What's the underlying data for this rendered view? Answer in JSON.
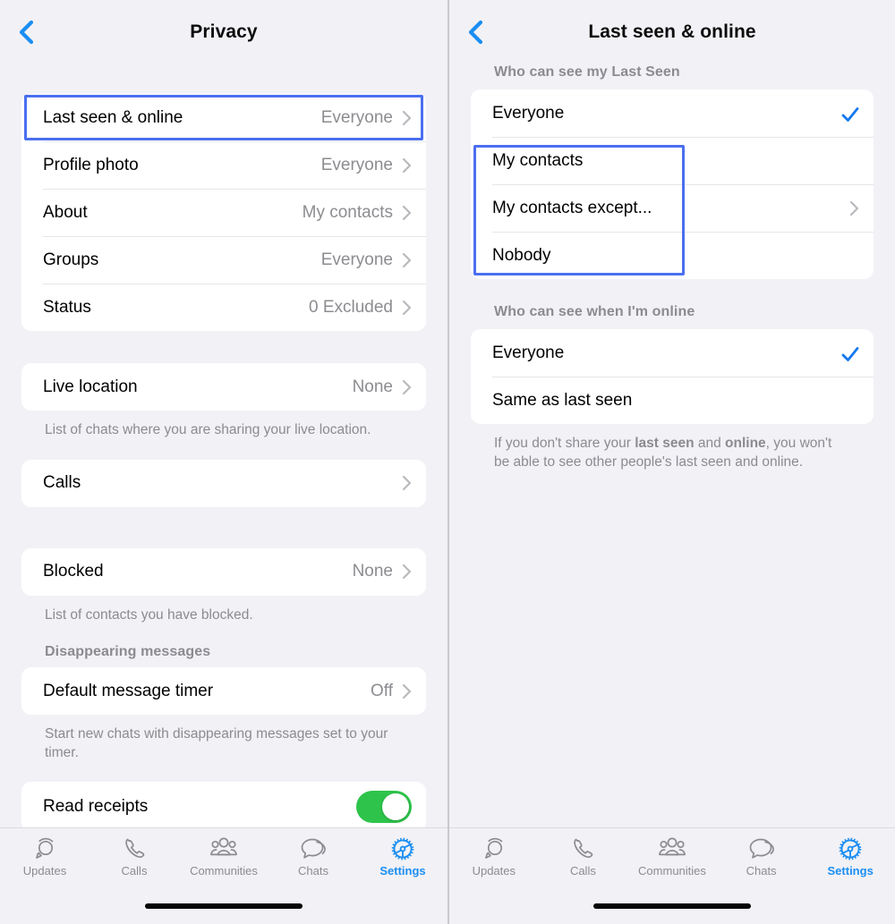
{
  "theme": {
    "background": "#f2f1f6",
    "card": "#ffffff",
    "accent_blue": "#1b8ef2",
    "highlight_border": "#4a6ff0",
    "toggle_on": "#2ec44b",
    "secondary_text": "#8b8b90"
  },
  "left_panel": {
    "header": {
      "title": "Privacy",
      "back_icon": "chevron-left-icon"
    },
    "group_1": [
      {
        "label": "Last seen & online",
        "value": "Everyone",
        "accessory": "chevron-right-icon",
        "highlighted": true
      },
      {
        "label": "Profile photo",
        "value": "Everyone",
        "accessory": "chevron-right-icon"
      },
      {
        "label": "About",
        "value": "My contacts",
        "accessory": "chevron-right-icon"
      },
      {
        "label": "Groups",
        "value": "Everyone",
        "accessory": "chevron-right-icon"
      },
      {
        "label": "Status",
        "value": "0 Excluded",
        "accessory": "chevron-right-icon"
      }
    ],
    "group_2": [
      {
        "label": "Live location",
        "value": "None",
        "accessory": "chevron-right-icon"
      }
    ],
    "caption_2": "List of chats where you are sharing your live location.",
    "group_3": [
      {
        "label": "Calls",
        "value": "",
        "accessory": "chevron-right-icon"
      }
    ],
    "group_4": [
      {
        "label": "Blocked",
        "value": "None",
        "accessory": "chevron-right-icon"
      }
    ],
    "caption_4": "List of contacts you have blocked.",
    "section_disappearing": "Disappearing messages",
    "group_5": [
      {
        "label": "Default message timer",
        "value": "Off",
        "accessory": "chevron-right-icon"
      }
    ],
    "caption_5": "Start new chats with disappearing messages set to your timer.",
    "group_6": [
      {
        "label": "Read receipts",
        "value": "",
        "accessory": "toggle-on"
      }
    ]
  },
  "right_panel": {
    "header": {
      "title": "Last seen & online",
      "back_icon": "chevron-left-icon"
    },
    "section_1_header": "Who can see my Last Seen",
    "group_1": [
      {
        "label": "Everyone",
        "accessory": "check-icon",
        "selected": true
      },
      {
        "label": "My contacts",
        "accessory": "",
        "selected": false
      },
      {
        "label": "My contacts except...",
        "accessory": "chevron-right-icon",
        "selected": false
      },
      {
        "label": "Nobody",
        "accessory": "",
        "selected": false
      }
    ],
    "section_2_header": "Who can see when I'm online",
    "group_2": [
      {
        "label": "Everyone",
        "accessory": "check-icon",
        "selected": true
      },
      {
        "label": "Same as last seen",
        "accessory": "",
        "selected": false
      }
    ],
    "caption_2_part1": "If you don't share your ",
    "caption_2_bold1": "last seen",
    "caption_2_part2": " and ",
    "caption_2_bold2": "online",
    "caption_2_part3": ", you won't be able to see other people's last seen and online."
  },
  "tabbar": {
    "items": [
      {
        "label": "Updates",
        "icon": "updates-icon",
        "active": false
      },
      {
        "label": "Calls",
        "icon": "phone-icon",
        "active": false
      },
      {
        "label": "Communities",
        "icon": "communities-icon",
        "active": false
      },
      {
        "label": "Chats",
        "icon": "chats-icon",
        "active": false
      },
      {
        "label": "Settings",
        "icon": "gear-icon",
        "active": true
      }
    ]
  }
}
